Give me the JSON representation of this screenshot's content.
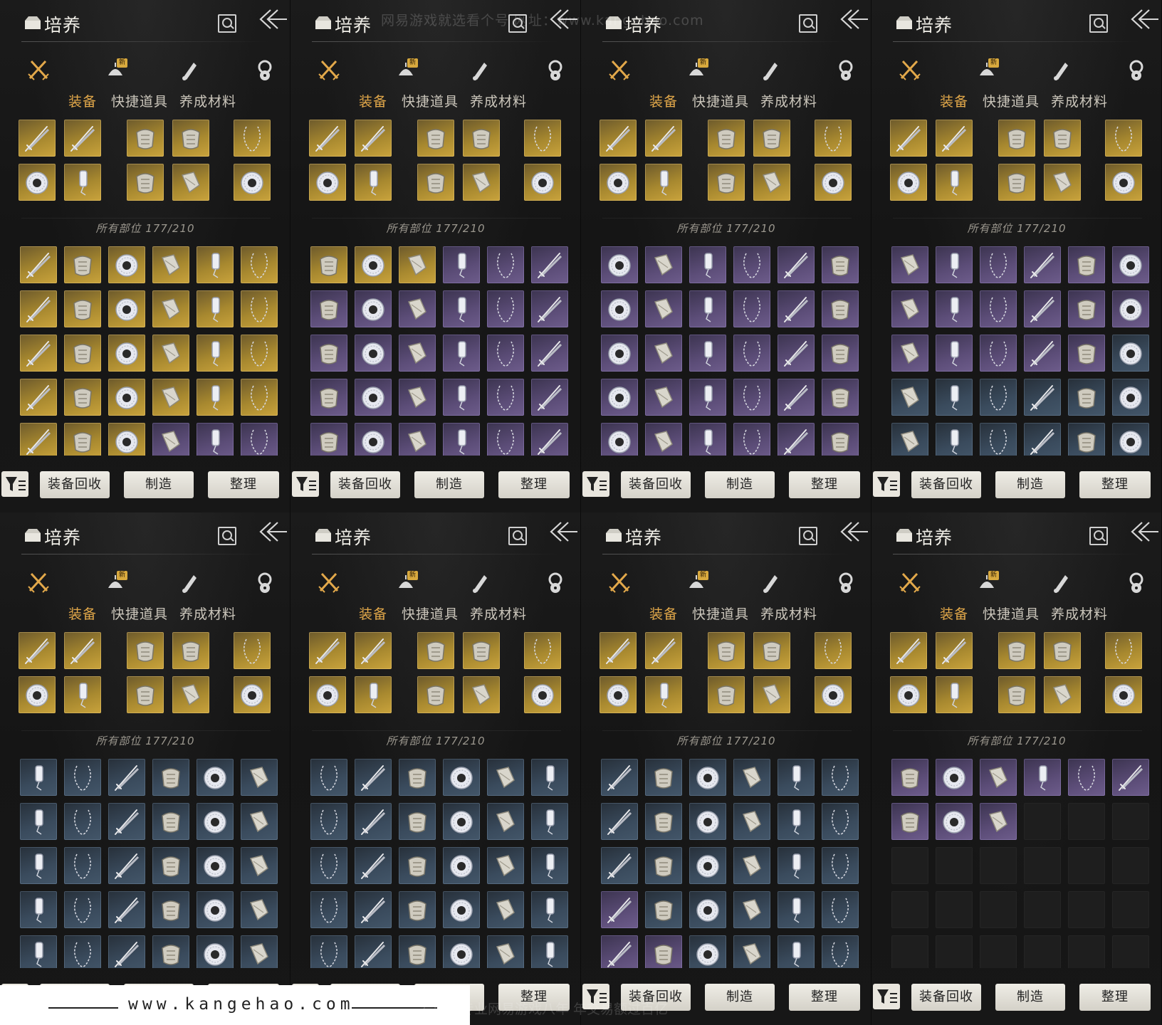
{
  "header": {
    "title": "培养",
    "search_icon": "search-icon",
    "back_icon": "back-arrows-icon"
  },
  "icon_tabs": [
    {
      "name": "equipment-tab-icon",
      "new_label": ""
    },
    {
      "name": "consumable-tab-icon",
      "new_label": "新"
    },
    {
      "name": "scroll-tab-icon",
      "new_label": ""
    },
    {
      "name": "material-tab-icon",
      "new_label": ""
    }
  ],
  "text_tabs": [
    {
      "label": "装备",
      "active": true
    },
    {
      "label": "快捷道具",
      "active": false
    },
    {
      "label": "养成材料",
      "active": false
    }
  ],
  "count_label": "所有部位 177/210",
  "buttons": {
    "recycle": "装备回收",
    "craft": "制造",
    "sort": "整理"
  },
  "colors": {
    "gold": "#c9a33c",
    "purple": "#6d5c8b",
    "blue": "#435669",
    "active_tab": "#e2a84a"
  },
  "watermark": {
    "top": "网易游戏就选看个号 网址：www.kangehao.com",
    "url": "www.kangehao.com",
    "bottom": "看个号专业网易游戏八年 年交易额过百亿"
  },
  "panels": [
    {
      "inventory_rows": [
        "GGGGGG",
        "GGGGGG",
        "GGGGGG",
        "GGGGGG",
        "GGGPPP"
      ]
    },
    {
      "inventory_rows": [
        "GGGPPP",
        "PPPPPP",
        "PPPPPP",
        "PPPPPP",
        "PPPPPP"
      ]
    },
    {
      "inventory_rows": [
        "PPPPPP",
        "PPPPPP",
        "PPPPPP",
        "PPPPPP",
        "PPPPPP"
      ]
    },
    {
      "inventory_rows": [
        "PPPPPP",
        "PPPPPP",
        "PPPPPB",
        "BBBBBB",
        "BBBBBB"
      ]
    },
    {
      "inventory_rows": [
        "BBBBBB",
        "BBBBBB",
        "BBBBBB",
        "BBBBBB",
        "BBBBBB"
      ]
    },
    {
      "inventory_rows": [
        "BBBBBB",
        "BBBBBB",
        "BBBBBB",
        "BBBBBB",
        "BBBBBB"
      ]
    },
    {
      "inventory_rows": [
        "BBBBBB",
        "BBBBBB",
        "BBBBBB",
        "PBBBBB",
        "PPBBBB"
      ]
    },
    {
      "inventory_rows": [
        "PPPPPP",
        "PPPEEE",
        "EEEEEE",
        "EEEEEE",
        "EEEEEE"
      ]
    }
  ],
  "icon_types": [
    "sword",
    "armor",
    "ring",
    "shawl",
    "pendant",
    "necklace"
  ]
}
